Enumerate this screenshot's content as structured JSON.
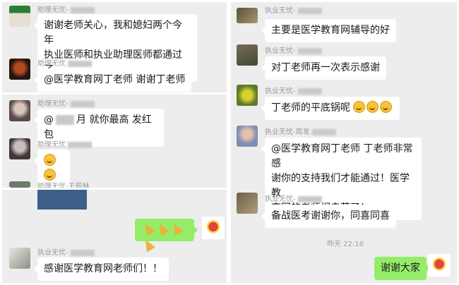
{
  "left_panel_1": {
    "messages": [
      {
        "name": "助理无忧-",
        "text_lines": [
          "谢谢老师关心，我和媳妇两个今年",
          "执业医师和执业助理医师都通过了"
        ]
      },
      {
        "name": "助理无忧",
        "text_lines": [
          "@医学教育网丁老师  谢谢丁老师"
        ]
      }
    ]
  },
  "left_panel_2": {
    "messages": [
      {
        "name": "助理无忧-",
        "text_lines": [
          "@",
          "月  就你最高  发红包"
        ]
      },
      {
        "name": "助理无忧",
        "emojis": [
          "smile-face",
          "smile-face"
        ]
      },
      {
        "name": "助理无忧-王辰林"
      }
    ]
  },
  "left_panel_3": {
    "messages": [
      {
        "name": "执业无忧-",
        "text_lines": [
          "感谢医学教育网老师们！！"
        ]
      }
    ],
    "sent": {
      "emojis": [
        "party-popper",
        "party-popper",
        "party-popper",
        "party-popper"
      ]
    }
  },
  "right_panel": {
    "messages": [
      {
        "name": "执业无忧-",
        "text_lines": [
          "主要是医学教育网辅导的好"
        ]
      },
      {
        "name": "执业无忧-",
        "text_lines": [
          "对丁老师再一次表示感谢"
        ]
      },
      {
        "name": "执业无忧-",
        "text_lines": [
          "丁老师的平底锅呢"
        ],
        "emojis": [
          "smile-face",
          "smile-face",
          "smile-face"
        ]
      },
      {
        "name": "执业无忧-周发",
        "text_lines": [
          "@医学教育网丁老师  丁老师非常感",
          "谢你的支持我们才能通过！医学教",
          "育网的老师们幸苦了！"
        ]
      },
      {
        "name": "执业无忧-",
        "text_lines": [
          "备战医考谢谢你，同喜同喜"
        ]
      }
    ],
    "timestamp": "昨天 22:16",
    "sent": {
      "text": "谢谢大家"
    }
  },
  "colors": {
    "chat_bg": "#ededed",
    "bubble_white": "#ffffff",
    "bubble_green": "#95ec69",
    "name_gray": "#9a9a9a"
  }
}
